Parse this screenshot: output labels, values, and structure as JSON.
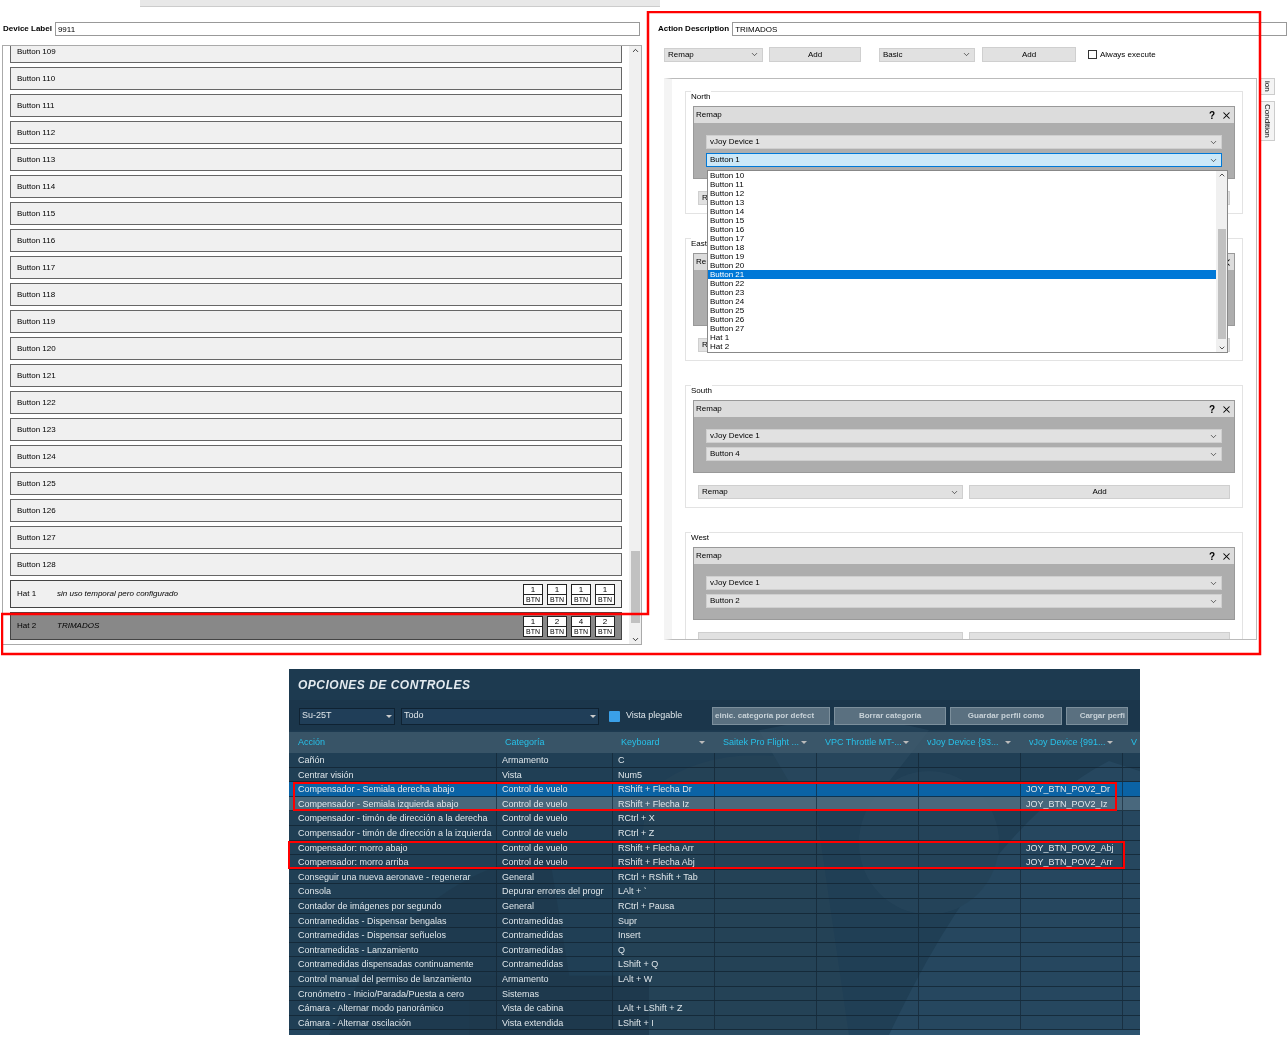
{
  "device_label": {
    "label": "Device Label",
    "value": "9911"
  },
  "inputs": [
    {
      "kind": "button",
      "name": "Button 109",
      "selected": false
    },
    {
      "kind": "button",
      "name": "Button 110",
      "selected": false
    },
    {
      "kind": "button",
      "name": "Button 111",
      "selected": false
    },
    {
      "kind": "button",
      "name": "Button 112",
      "selected": false
    },
    {
      "kind": "button",
      "name": "Button 113",
      "selected": false
    },
    {
      "kind": "button",
      "name": "Button 114",
      "selected": false
    },
    {
      "kind": "button",
      "name": "Button 115",
      "selected": false
    },
    {
      "kind": "button",
      "name": "Button 116",
      "selected": false
    },
    {
      "kind": "button",
      "name": "Button 117",
      "selected": false
    },
    {
      "kind": "button",
      "name": "Button 118",
      "selected": false
    },
    {
      "kind": "button",
      "name": "Button 119",
      "selected": false
    },
    {
      "kind": "button",
      "name": "Button 120",
      "selected": false
    },
    {
      "kind": "button",
      "name": "Button 121",
      "selected": false
    },
    {
      "kind": "button",
      "name": "Button 122",
      "selected": false
    },
    {
      "kind": "button",
      "name": "Button 123",
      "selected": false
    },
    {
      "kind": "button",
      "name": "Button 124",
      "selected": false
    },
    {
      "kind": "button",
      "name": "Button 125",
      "selected": false
    },
    {
      "kind": "button",
      "name": "Button 126",
      "selected": false
    },
    {
      "kind": "button",
      "name": "Button 127",
      "selected": false
    },
    {
      "kind": "button",
      "name": "Button 128",
      "selected": false
    },
    {
      "kind": "hat",
      "name": "Hat 1",
      "description": "sin uso temporal pero configurado",
      "selected": false,
      "badges": [
        {
          "count": "1",
          "unit": "BTN"
        },
        {
          "count": "1",
          "unit": "BTN"
        },
        {
          "count": "1",
          "unit": "BTN"
        },
        {
          "count": "1",
          "unit": "BTN"
        }
      ]
    },
    {
      "kind": "hat",
      "name": "Hat 2",
      "description": "TRIMADOS",
      "selected": true,
      "badges": [
        {
          "count": "1",
          "unit": "BTN"
        },
        {
          "count": "2",
          "unit": "BTN"
        },
        {
          "count": "4",
          "unit": "BTN"
        },
        {
          "count": "2",
          "unit": "BTN"
        }
      ]
    }
  ],
  "action": {
    "label": "Action Description",
    "value": "TRIMADOS"
  },
  "toolbar": {
    "action_select": "Remap",
    "add_action": "Add",
    "container_select": "Basic",
    "add_container": "Add",
    "always_execute": {
      "label": "Always execute",
      "checked": false
    }
  },
  "side_tabs": [
    "ion",
    "Condition"
  ],
  "directions": [
    {
      "title": "North",
      "remap": {
        "title": "Remap",
        "help": "?",
        "device": "vJoy Device 1",
        "target": "Button 1",
        "target_focused": true
      },
      "footer": {
        "select": "R"
      }
    },
    {
      "title": "East",
      "remap": {
        "title": "Re"
      },
      "footer": {
        "select": "R"
      }
    },
    {
      "title": "South",
      "remap": {
        "title": "Remap",
        "help": "?",
        "device": "vJoy Device 1",
        "target": "Button 4",
        "target_focused": false
      },
      "footer": {
        "select": "Remap",
        "button": "Add"
      }
    },
    {
      "title": "West",
      "remap": {
        "title": "Remap",
        "help": "?",
        "device": "vJoy Device 1",
        "target": "Button 2",
        "target_focused": false
      }
    }
  ],
  "dropdown": {
    "items": [
      {
        "label": "Button 10",
        "selected": false
      },
      {
        "label": "Button 11",
        "selected": false
      },
      {
        "label": "Button 12",
        "selected": false
      },
      {
        "label": "Button 13",
        "selected": false
      },
      {
        "label": "Button 14",
        "selected": false
      },
      {
        "label": "Button 15",
        "selected": false
      },
      {
        "label": "Button 16",
        "selected": false
      },
      {
        "label": "Button 17",
        "selected": false
      },
      {
        "label": "Button 18",
        "selected": false
      },
      {
        "label": "Button 19",
        "selected": false
      },
      {
        "label": "Button 20",
        "selected": false
      },
      {
        "label": "Button 21",
        "selected": true
      },
      {
        "label": "Button 22",
        "selected": false
      },
      {
        "label": "Button 23",
        "selected": false
      },
      {
        "label": "Button 24",
        "selected": false
      },
      {
        "label": "Button 25",
        "selected": false
      },
      {
        "label": "Button 26",
        "selected": false
      },
      {
        "label": "Button 27",
        "selected": false
      },
      {
        "label": "Hat 1",
        "selected": false
      },
      {
        "label": "Hat 2",
        "selected": false
      }
    ]
  },
  "dcs": {
    "title": "OPCIONES DE CONTROLES",
    "aircraft": "Su-25T",
    "category_filter": "Todo",
    "collapsible_view": {
      "label": "Vista plegable",
      "checked": true
    },
    "buttons": [
      "einic. categoría por defect",
      "Borrar categoría",
      "Guardar perfil como",
      "Cargar perfi"
    ],
    "columns": [
      {
        "label": "Acción",
        "menu": false
      },
      {
        "label": "Categoría",
        "menu": false
      },
      {
        "label": "Keyboard",
        "menu": true
      },
      {
        "label": "Saitek Pro Flight ...",
        "menu": true
      },
      {
        "label": "VPC Throttle MT-...",
        "menu": true
      },
      {
        "label": "vJoy Device {93...",
        "menu": true
      },
      {
        "label": "vJoy Device {991...",
        "menu": true
      },
      {
        "label": "V",
        "menu": false
      }
    ],
    "rows": [
      {
        "action": "Cañón",
        "category": "Armamento",
        "keyboard": "C",
        "selected": false,
        "hover": false
      },
      {
        "action": "Centrar visión",
        "category": "Vista",
        "keyboard": "Num5",
        "selected": false,
        "hover": false
      },
      {
        "action": "Compensador - Semiala derecha abajo",
        "category": "Control de vuelo",
        "keyboard": "RShift + Flecha Dr",
        "vjoy": "JOY_BTN_POV2_Dr",
        "selected": true,
        "hover": false
      },
      {
        "action": "Compensador - Semiala izquierda abajo",
        "category": "Control de vuelo",
        "keyboard": "RShift + Flecha Iz",
        "vjoy": "JOY_BTN_POV2_Iz",
        "selected": false,
        "hover": true
      },
      {
        "action": "Compensador - timón de dirección a la derecha",
        "category": "Control de vuelo",
        "keyboard": "RCtrl + X",
        "selected": false,
        "hover": false
      },
      {
        "action": "Compensador - timón de dirección a la izquierda",
        "category": "Control de vuelo",
        "keyboard": "RCtrl + Z",
        "selected": false,
        "hover": false
      },
      {
        "action": "Compensador: morro abajo",
        "category": "Control de vuelo",
        "keyboard": "RShift + Flecha Arr",
        "vjoy": "JOY_BTN_POV2_Abj",
        "selected": false,
        "hover": false
      },
      {
        "action": "Compensador: morro arriba",
        "category": "Control de vuelo",
        "keyboard": "RShift + Flecha Abj",
        "vjoy": "JOY_BTN_POV2_Arr",
        "selected": false,
        "hover": false
      },
      {
        "action": "Conseguir una nueva aeronave - regenerar",
        "category": "General",
        "keyboard": "RCtrl + RShift + Tab",
        "selected": false,
        "hover": false
      },
      {
        "action": "Consola",
        "category": "Depurar errores del progr",
        "keyboard": "LAlt + `",
        "selected": false,
        "hover": false
      },
      {
        "action": "Contador de imágenes por segundo",
        "category": "General",
        "keyboard": "RCtrl + Pausa",
        "selected": false,
        "hover": false
      },
      {
        "action": "Contramedidas - Dispensar bengalas",
        "category": "Contramedidas",
        "keyboard": "Supr",
        "selected": false,
        "hover": false
      },
      {
        "action": "Contramedidas - Dispensar señuelos",
        "category": "Contramedidas",
        "keyboard": "Insert",
        "selected": false,
        "hover": false
      },
      {
        "action": "Contramedidas - Lanzamiento",
        "category": "Contramedidas",
        "keyboard": "Q",
        "selected": false,
        "hover": false
      },
      {
        "action": "Contramedidas dispensadas continuamente",
        "category": "Contramedidas",
        "keyboard": "LShift + Q",
        "selected": false,
        "hover": false
      },
      {
        "action": "Control manual del permiso de lanzamiento",
        "category": "Armamento",
        "keyboard": "LAlt + W",
        "selected": false,
        "hover": false
      },
      {
        "action": "Cronómetro - Inicio/Parada/Puesta a cero",
        "category": "Sistemas",
        "selected": false,
        "hover": false
      },
      {
        "action": "Cámara - Alternar modo panorámico",
        "category": "Vista de cabina",
        "keyboard": "LAlt + LShift + Z",
        "selected": false,
        "hover": false
      },
      {
        "action": "Cámara - Alternar oscilación",
        "category": "Vista extendida",
        "keyboard": "LShift + I",
        "selected": false,
        "hover": false
      }
    ]
  }
}
